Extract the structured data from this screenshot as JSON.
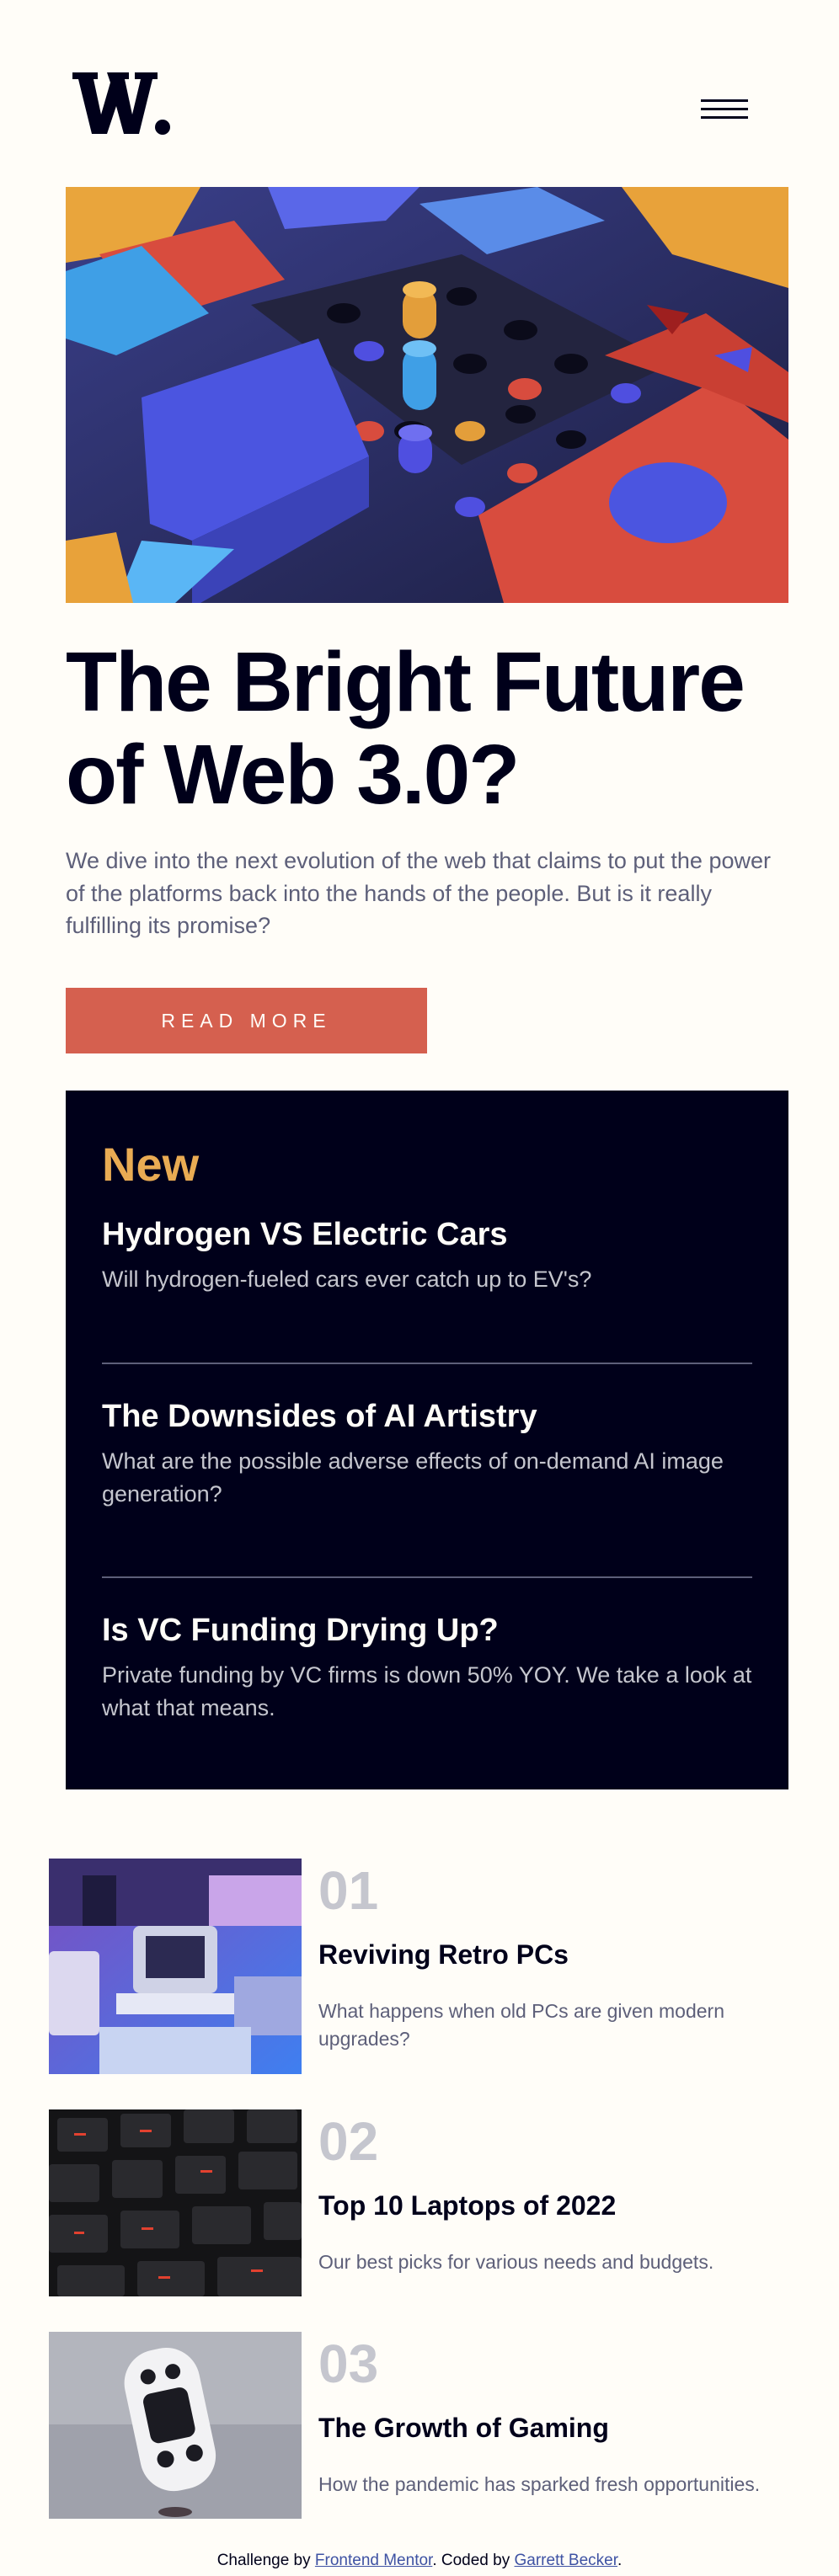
{
  "header": {
    "logo_text": "W.",
    "menu_icon": "hamburger-icon"
  },
  "hero": {
    "image_alt": "colorful 3D geometric blocks",
    "title_line1": "The Bright Future",
    "title_line2": "of Web 3.0?",
    "text": "We dive into the next evolution of the web that claims to put the power of the platforms back into the hands of the people. But is it really fulfilling its promise?",
    "button_label": "READ MORE"
  },
  "new_section": {
    "heading": "New",
    "items": [
      {
        "title": "Hydrogen VS Electric Cars",
        "text": "Will hydrogen-fueled cars ever catch up to EV's?"
      },
      {
        "title": "The Downsides of AI Artistry",
        "text": "What are the possible adverse effects of on-demand AI image generation?"
      },
      {
        "title": "Is VC Funding Drying Up?",
        "text": "Private funding by VC firms is down 50% YOY. We take a look at what that means."
      }
    ]
  },
  "articles": [
    {
      "number": "01",
      "title": "Reviving Retro PCs",
      "text": "What happens when old PCs are given modern upgrades?"
    },
    {
      "number": "02",
      "title": "Top 10 Laptops of 2022",
      "text": "Our best picks for various needs and budgets."
    },
    {
      "number": "03",
      "title": "The Growth of Gaming",
      "text": "How the pandemic has sparked fresh opportunities."
    }
  ],
  "footer": {
    "prefix": "Challenge by ",
    "link1": "Frontend Mentor",
    "middle": ". Coded by ",
    "link2": "Garrett Becker",
    "suffix": "."
  },
  "colors": {
    "background": "#fffdf8",
    "dark": "#00001a",
    "accent_red": "#d5604f",
    "accent_orange": "#e9ab53",
    "grayish_blue": "#5d5f79",
    "light_gray": "#c5c6ce"
  }
}
